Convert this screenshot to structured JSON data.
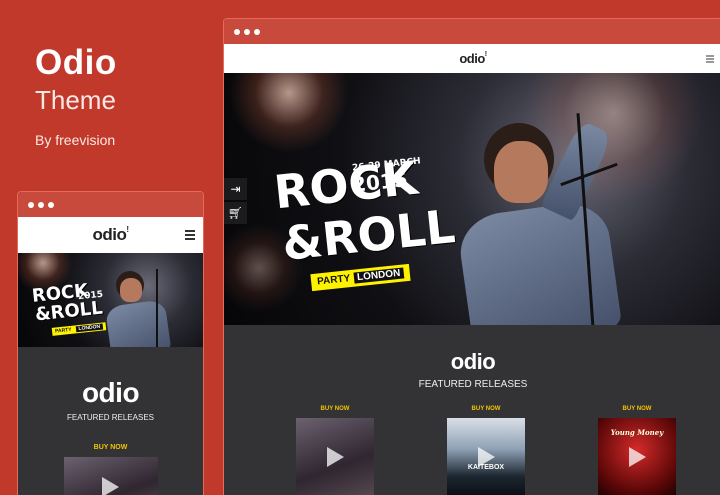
{
  "promo": {
    "title": "Odio",
    "subtitle": "Theme",
    "byline": "By freevision"
  },
  "site": {
    "logo": "odio",
    "logo_mark": "!"
  },
  "hero": {
    "line1": "ROCK",
    "line2": "&ROLL",
    "date_line1": "26-29 MARCH",
    "date_line2": "2015",
    "party": "PARTY",
    "london": "LONDON"
  },
  "releases": {
    "logo": "odio",
    "heading": "FEATURED RELEASES",
    "buy_label": "BUY NOW",
    "albums": [
      {
        "buy": "BUY NOW",
        "tag": ""
      },
      {
        "buy": "BUY NOW",
        "tag": "KAITEBOX"
      },
      {
        "buy": "BUY NOW",
        "tag": "Young Money"
      }
    ]
  },
  "icons": {
    "menu": "hamburger-icon",
    "login": "login-icon",
    "cart": "cart-icon",
    "play": "play-icon"
  },
  "colors": {
    "background": "#c0392b",
    "accent": "#f2c400",
    "dark": "#333335"
  }
}
